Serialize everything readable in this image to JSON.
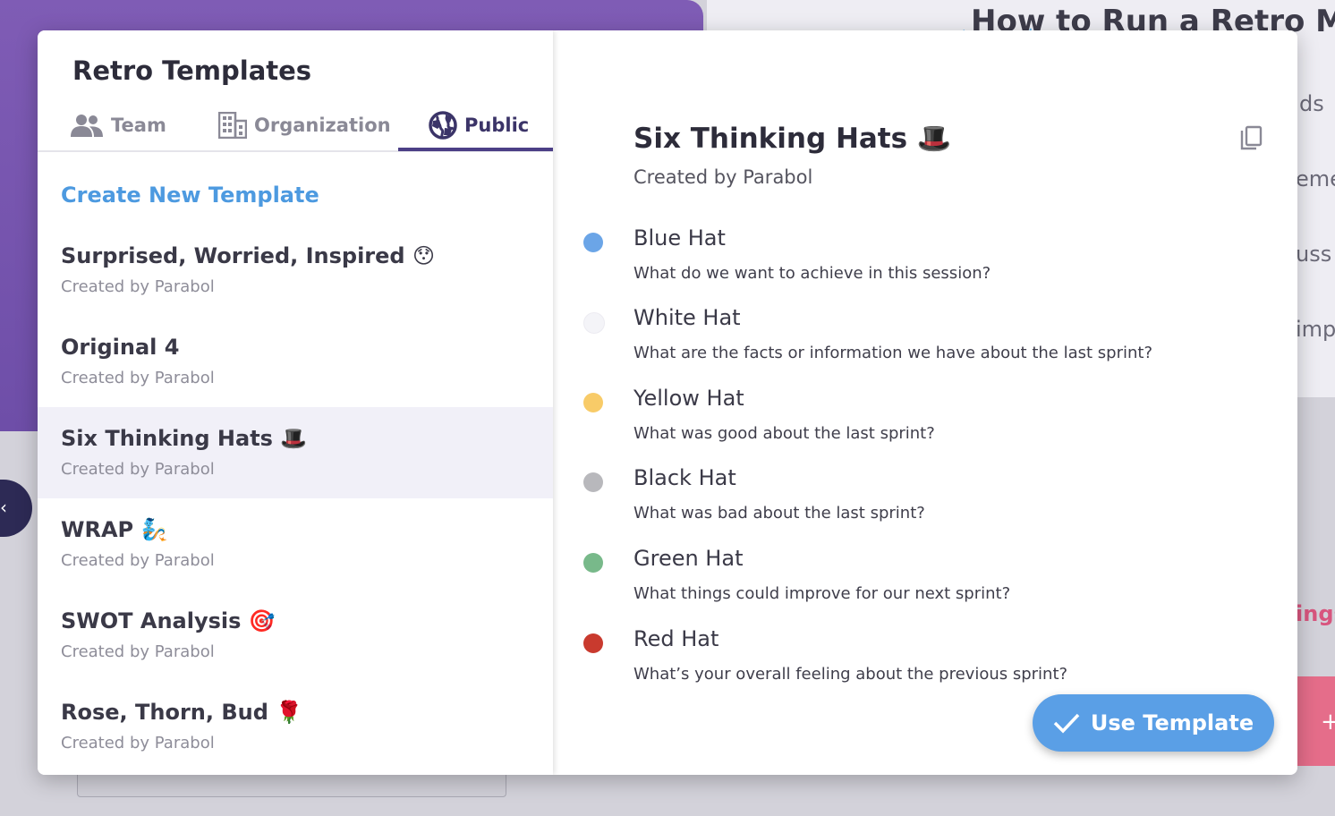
{
  "background": {
    "article_title": "How to Run a Retro Mee",
    "fragments": [
      "ds",
      "eme",
      "uss",
      "imp",
      "ings"
    ],
    "plus_label": "+"
  },
  "templates": {
    "title": "Retro Templates",
    "tabs": [
      {
        "label": "Team",
        "icon": "team-icon"
      },
      {
        "label": "Organization",
        "icon": "organization-icon"
      },
      {
        "label": "Public",
        "icon": "globe-icon",
        "active": true
      }
    ],
    "create_label": "Create New Template",
    "items": [
      {
        "name": "Surprised, Worried, Inspired 😯",
        "meta": "Created by Parabol"
      },
      {
        "name": "Original 4",
        "meta": "Created by Parabol"
      },
      {
        "name": "Six Thinking Hats 🎩",
        "meta": "Created by Parabol",
        "selected": true
      },
      {
        "name": "WRAP 🧞",
        "meta": "Created by Parabol"
      },
      {
        "name": "SWOT Analysis 🎯",
        "meta": "Created by Parabol"
      },
      {
        "name": "Rose, Thorn, Bud 🌹",
        "meta": "Created by Parabol"
      }
    ]
  },
  "detail": {
    "title": "Six Thinking Hats 🎩",
    "meta": "Created by Parabol",
    "prompts": [
      {
        "name": "Blue Hat",
        "desc": "What do we want to achieve in this session?",
        "color": "#6ba5e7"
      },
      {
        "name": "White Hat",
        "desc": "What are the facts or information we have about the last sprint?",
        "color": "#f4f4f8"
      },
      {
        "name": "Yellow Hat",
        "desc": "What was good about the last sprint?",
        "color": "#f8cb68"
      },
      {
        "name": "Black Hat",
        "desc": "What was bad about the last sprint?",
        "color": "#b8b8bc"
      },
      {
        "name": "Green Hat",
        "desc": "What things could improve for our next sprint?",
        "color": "#78b98a"
      },
      {
        "name": "Red Hat",
        "desc": "What’s your overall feeling about the previous sprint?",
        "color": "#c93a2e"
      }
    ],
    "use_label": "Use Template"
  }
}
